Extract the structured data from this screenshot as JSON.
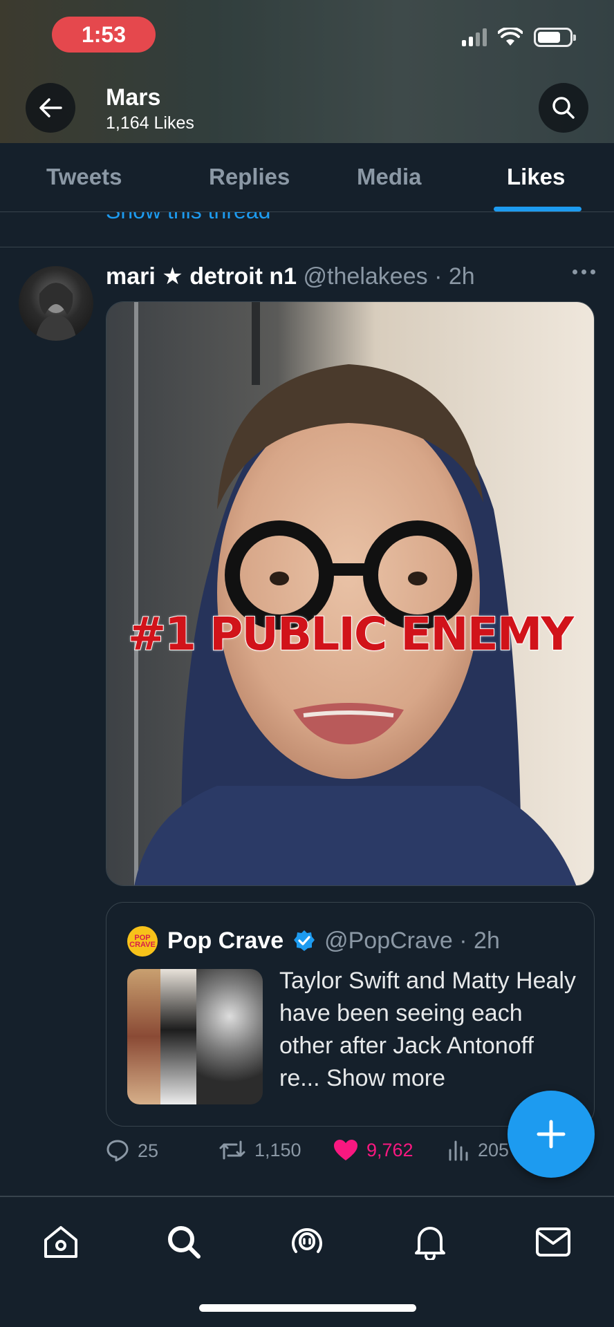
{
  "status_bar": {
    "time": "1:53"
  },
  "header": {
    "name": "Mars",
    "likes_count": "1,164 Likes"
  },
  "tabs": [
    {
      "label": "Tweets"
    },
    {
      "label": "Replies"
    },
    {
      "label": "Media"
    },
    {
      "label": "Likes",
      "active": true
    }
  ],
  "previous_tweet": {
    "thread_link": "Show this thread"
  },
  "tweet": {
    "author_name": "mari ★ detroit n1",
    "author_handle": "@thelakees",
    "time": "· 2h",
    "media_caption": "#1 PUBLIC ENEMY",
    "quote": {
      "avatar_text": "POP CRAVE",
      "author_name": "Pop Crave",
      "author_handle": "@PopCrave",
      "time": "· 2h",
      "text": "Taylor Swift and Matty Healy have been seeing each other after Jack Antonoff re...",
      "show_more": "Show more"
    },
    "actions": {
      "replies": "25",
      "retweets": "1,150",
      "likes": "9,762",
      "views": "205"
    }
  },
  "colors": {
    "accent": "#1d9bf0",
    "like": "#f91880",
    "background": "#15202b"
  },
  "icons": [
    "back-arrow-icon",
    "search-icon",
    "more-icon",
    "verified-icon",
    "reply-icon",
    "retweet-icon",
    "heart-icon",
    "views-icon",
    "compose-plus-icon",
    "home-icon",
    "explore-icon",
    "spaces-icon",
    "notifications-icon",
    "messages-icon"
  ]
}
